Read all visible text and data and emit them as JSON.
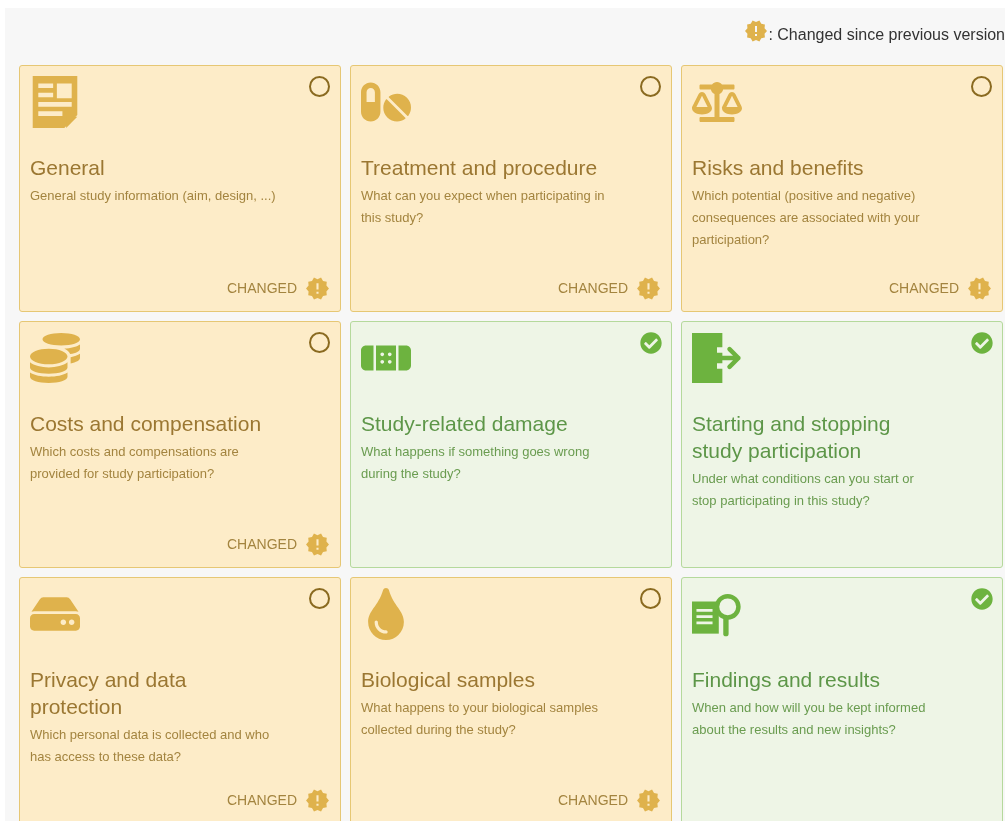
{
  "legend": {
    "text": ": Changed since previous version"
  },
  "cards": [
    {
      "kind": "document",
      "title": "General",
      "description": "General study information (aim, design, ...)",
      "checked": false,
      "changed": "CHANGED"
    },
    {
      "kind": "pills",
      "title": "Treatment and procedure",
      "description": "What can you expect when participating in this study?",
      "checked": false,
      "changed": "CHANGED"
    },
    {
      "kind": "scales",
      "title": "Risks and benefits",
      "description": "Which potential (positive and negative) consequences are associated with your participation?",
      "checked": false,
      "changed": "CHANGED"
    },
    {
      "kind": "coins",
      "title": "Costs and compensation",
      "description": "Which costs and compensations are provided for study participation?",
      "checked": false,
      "changed": "CHANGED"
    },
    {
      "kind": "bandage",
      "title": "Study-related damage",
      "description": "What happens if something goes wrong during the study?",
      "checked": true
    },
    {
      "kind": "exit",
      "title": "Starting and stopping study participation",
      "description": "Under what conditions can you start or stop participating in this study?",
      "checked": true
    },
    {
      "kind": "drive",
      "title": "Privacy and data protection",
      "description": "Which personal data is collected and who has access to these data?",
      "checked": false,
      "changed": "CHANGED"
    },
    {
      "kind": "drop",
      "title": "Biological samples",
      "description": "What happens to your biological samples collected during the study?",
      "checked": false,
      "changed": "CHANGED"
    },
    {
      "kind": "findings",
      "title": "Findings and results",
      "description": "When and how will you be kept informed about the results and new insights?",
      "checked": true
    }
  ]
}
